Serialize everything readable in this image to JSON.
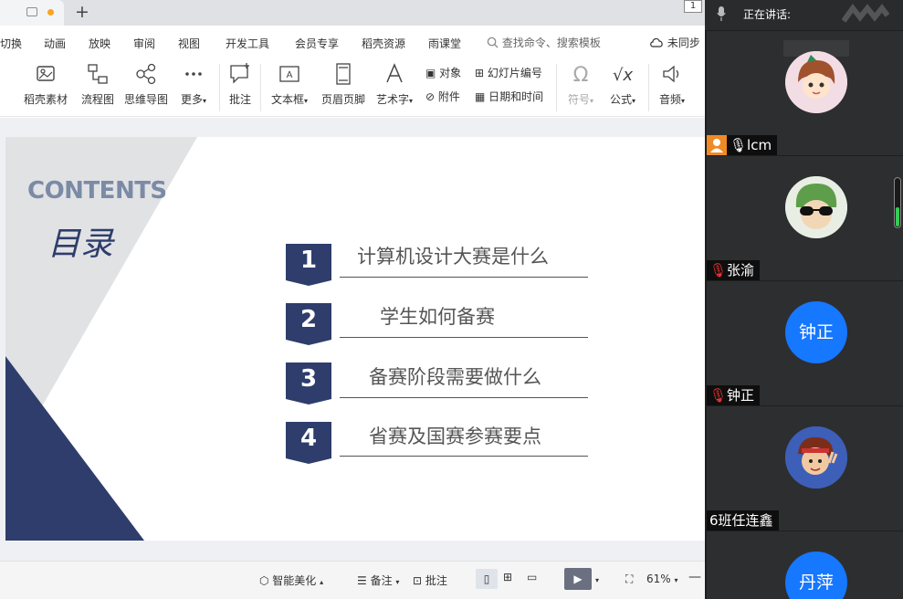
{
  "tabbar": {
    "page_indicator": "1"
  },
  "menu": {
    "items": [
      "切换",
      "动画",
      "放映",
      "审阅",
      "视图",
      "开发工具",
      "会员专享",
      "稻壳资源",
      "雨课堂"
    ],
    "search_placeholder": "查找命令、搜索模板",
    "sync_label": "未同步"
  },
  "ribbon": {
    "buttons": [
      "稻壳素材",
      "流程图",
      "思维导图",
      "更多",
      "批注",
      "文本框",
      "页眉页脚",
      "艺术字"
    ],
    "object_label": "对象",
    "attachment_label": "附件",
    "slide_number_label": "幻灯片编号",
    "datetime_label": "日期和时间",
    "symbol_label": "符号",
    "formula_label": "公式",
    "audio_label": "音频"
  },
  "slide": {
    "contents_title": "CONTENTS",
    "mulu_title": "目录",
    "items": [
      {
        "num": "1",
        "text": "计算机设计大赛是什么"
      },
      {
        "num": "2",
        "text": "学生如何备赛"
      },
      {
        "num": "3",
        "text": "备赛阶段需要做什么"
      },
      {
        "num": "4",
        "text": "省赛及国赛参赛要点"
      }
    ],
    "colors": {
      "navy": "#2e3d6b",
      "gray_band": "#e1e2e4",
      "contents": "#7b8ba6"
    }
  },
  "statusbar": {
    "beautify_label": "智能美化",
    "notes_label": "备注",
    "comment_label": "批注",
    "zoom": "61%"
  },
  "meeting": {
    "speaking_label": "正在讲话:",
    "participants": [
      {
        "name": "lcm",
        "host": true,
        "mic": "on"
      },
      {
        "name": "张渝",
        "host": false,
        "mic": "muted"
      },
      {
        "name": "钟正",
        "avatar_text": "钟正",
        "host": false,
        "mic": "muted"
      },
      {
        "name": "6班任连鑫",
        "host": false,
        "mic": "none"
      },
      {
        "name": "",
        "avatar_text": "丹萍",
        "host": false,
        "mic": "none"
      }
    ],
    "volume_level": 0.4,
    "avatar_blue": "#1677ff"
  }
}
